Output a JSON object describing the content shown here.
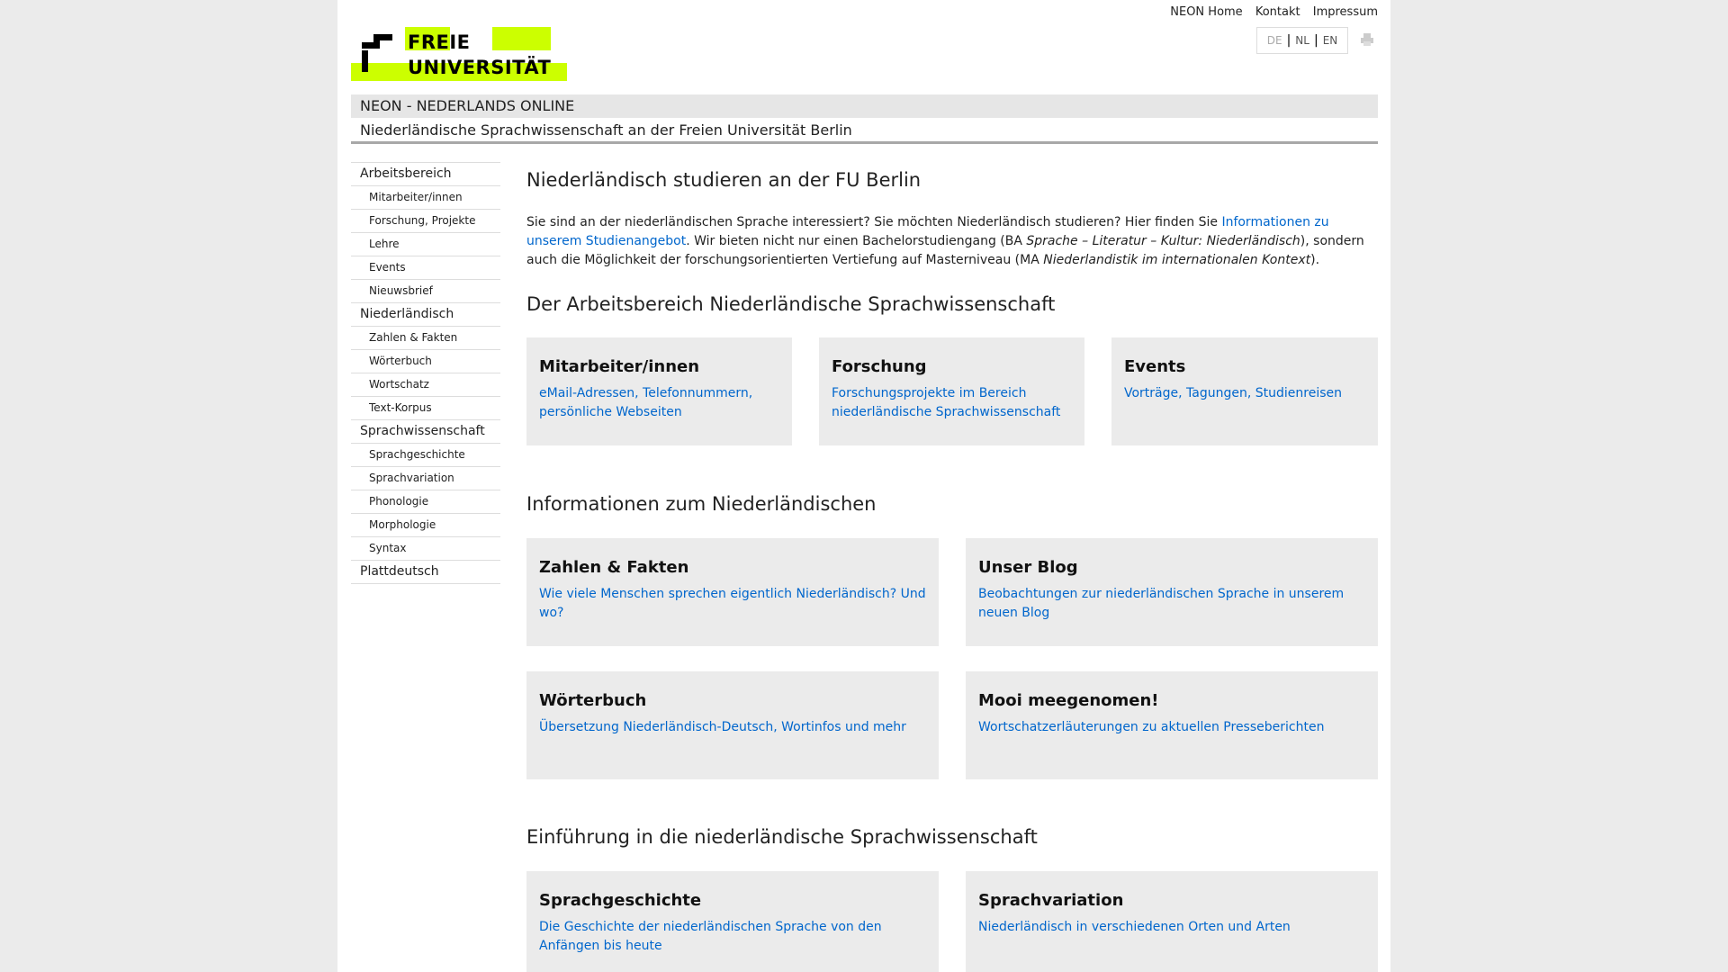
{
  "header": {
    "logo_line1": "FREIE",
    "logo_line2": "UNIVERSITÄT",
    "top_links": [
      "NEON Home",
      "Kontakt",
      "Impressum"
    ],
    "languages": [
      "DE",
      "NL",
      "EN"
    ],
    "active_language": "DE",
    "site_title": "NEON - NEDERLANDS ONLINE",
    "site_subtitle": "Niederländische Sprachwissenschaft an der Freien Universität Berlin"
  },
  "nav": {
    "items": [
      {
        "label": "Arbeitsbereich",
        "level": 1
      },
      {
        "label": "Mitarbeiter/innen",
        "level": 2
      },
      {
        "label": "Forschung, Projekte",
        "level": 2
      },
      {
        "label": "Lehre",
        "level": 2
      },
      {
        "label": "Events",
        "level": 2
      },
      {
        "label": "Nieuwsbrief",
        "level": 2
      },
      {
        "label": "Niederländisch",
        "level": 1
      },
      {
        "label": "Zahlen & Fakten",
        "level": 2
      },
      {
        "label": "Wörterbuch",
        "level": 2
      },
      {
        "label": "Wortschatz",
        "level": 2
      },
      {
        "label": "Text-Korpus",
        "level": 2
      },
      {
        "label": "Sprachwissenschaft",
        "level": 1
      },
      {
        "label": "Sprachgeschichte",
        "level": 2
      },
      {
        "label": "Sprachvariation",
        "level": 2
      },
      {
        "label": "Phonologie",
        "level": 2
      },
      {
        "label": "Morphologie",
        "level": 2
      },
      {
        "label": "Syntax",
        "level": 2
      },
      {
        "label": "Plattdeutsch",
        "level": 1
      }
    ]
  },
  "main": {
    "title": "Niederländisch studieren an der FU Berlin",
    "intro": {
      "t1": "Sie sind an der niederländischen Sprache interessiert? Sie möchten Niederländisch studieren? Hier finden Sie ",
      "link": "Informationen zu unserem Studienangebot",
      "t2": ". Wir bieten nicht nur einen Bachelorstudiengang (BA ",
      "ba": "Sprache – Literatur – Kultur: Niederländisch",
      "t3": "), sondern auch die Möglichkeit der forschungsorientierten Vertiefung auf Masterniveau (MA ",
      "ma": "Niederlandistik im internationalen Kontext",
      "t4": ")."
    },
    "sections": [
      {
        "title": "Der Arbeitsbereich Niederländische Sprachwissenschaft",
        "cards": [
          {
            "title": "Mitarbeiter/innen",
            "text": "eMail-Adressen, Telefonnummern, persönliche Webseiten"
          },
          {
            "title": "Forschung",
            "text": "Forschungsprojekte im Bereich niederländische Sprachwissenschaft"
          },
          {
            "title": "Events",
            "text": "Vorträge, Tagungen, Studienreisen"
          }
        ]
      },
      {
        "title": "Informationen zum Niederländischen",
        "cards": [
          {
            "title": "Zahlen & Fakten",
            "text": "Wie viele Menschen sprechen eigentlich Niederländisch? Und wo?"
          },
          {
            "title": "Unser Blog",
            "text": "Beobachtungen zur niederländischen Sprache in unserem neuen Blog"
          },
          {
            "title": "Wörterbuch",
            "text": "Übersetzung Niederländisch-Deutsch, Wortinfos und mehr"
          },
          {
            "title": "Mooi meegenomen!",
            "text": "Wortschatzerläuterungen zu aktuellen Presseberichten"
          }
        ]
      },
      {
        "title": "Einführung in die niederländische Sprachwissenschaft",
        "cards": [
          {
            "title": "Sprachgeschichte",
            "text": "Die Geschichte der niederländischen Sprache von den Anfängen bis heute"
          },
          {
            "title": "Sprachvariation",
            "text": "Niederländisch in verschiedenen Orten und Arten"
          }
        ]
      }
    ]
  },
  "colors": {
    "logo_accent": "#ccff00",
    "link": "#0066cc",
    "card_bg": "#ebebeb"
  },
  "icons": {
    "print": "printer-icon"
  }
}
